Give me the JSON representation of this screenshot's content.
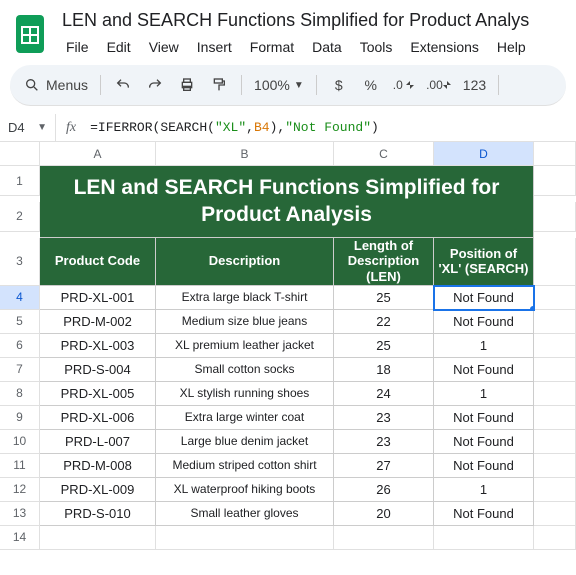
{
  "docTitle": "LEN and SEARCH Functions Simplified for Product Analys",
  "menus": [
    "File",
    "Edit",
    "View",
    "Insert",
    "Format",
    "Data",
    "Tools",
    "Extensions",
    "Help"
  ],
  "toolbar": {
    "menus": "Menus",
    "zoom": "100%",
    "numfmt": "123"
  },
  "nameBox": "D4",
  "formula": {
    "raw": "=IFERROR(SEARCH(\"XL\",B4),\"Not Found\")",
    "parts": [
      {
        "t": "=IFERROR(SEARCH(",
        "c": "fn"
      },
      {
        "t": "\"XL\"",
        "c": "str"
      },
      {
        "t": ",",
        "c": "fn"
      },
      {
        "t": "B4",
        "c": "ref"
      },
      {
        "t": "),",
        "c": "fn"
      },
      {
        "t": "\"Not Found\"",
        "c": "str"
      },
      {
        "t": ")",
        "c": "fn"
      }
    ]
  },
  "cols": [
    "A",
    "B",
    "C",
    "D"
  ],
  "bigTitle": "LEN and SEARCH Functions Simplified for Product Analysis",
  "headers": [
    "Product Code",
    "Description",
    "Length of Description (LEN)",
    "Position of 'XL' (SEARCH)"
  ],
  "rows": [
    {
      "n": 4,
      "code": "PRD-XL-001",
      "desc": "Extra large black T-shirt",
      "len": "25",
      "pos": "Not Found"
    },
    {
      "n": 5,
      "code": "PRD-M-002",
      "desc": "Medium size blue jeans",
      "len": "22",
      "pos": "Not Found"
    },
    {
      "n": 6,
      "code": "PRD-XL-003",
      "desc": "XL premium leather jacket",
      "len": "25",
      "pos": "1"
    },
    {
      "n": 7,
      "code": "PRD-S-004",
      "desc": "Small cotton socks",
      "len": "18",
      "pos": "Not Found"
    },
    {
      "n": 8,
      "code": "PRD-XL-005",
      "desc": "XL stylish running shoes",
      "len": "24",
      "pos": "1"
    },
    {
      "n": 9,
      "code": "PRD-XL-006",
      "desc": "Extra large winter coat",
      "len": "23",
      "pos": "Not Found"
    },
    {
      "n": 10,
      "code": "PRD-L-007",
      "desc": "Large blue denim jacket",
      "len": "23",
      "pos": "Not Found"
    },
    {
      "n": 11,
      "code": "PRD-M-008",
      "desc": "Medium striped cotton shirt",
      "len": "27",
      "pos": "Not Found"
    },
    {
      "n": 12,
      "code": "PRD-XL-009",
      "desc": "XL waterproof hiking boots",
      "len": "26",
      "pos": "1"
    },
    {
      "n": 13,
      "code": "PRD-S-010",
      "desc": "Small leather gloves",
      "len": "20",
      "pos": "Not Found"
    }
  ],
  "emptyRow": 14
}
